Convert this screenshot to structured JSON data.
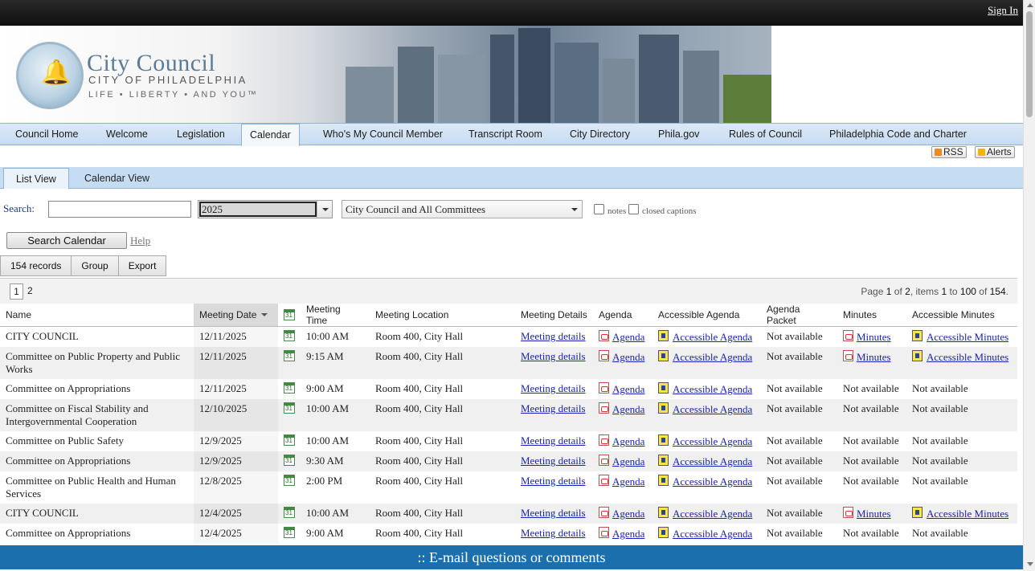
{
  "header": {
    "sign_in": "Sign In"
  },
  "logo": {
    "title": "City Council",
    "subtitle": "CITY OF PHILADELPHIA",
    "tagline": "LIFE • LIBERTY • AND YOU™"
  },
  "nav": {
    "items": [
      "Council Home",
      "Welcome",
      "Legislation",
      "Calendar",
      "Who's My Council Member",
      "Transcript Room",
      "City Directory",
      "Phila.gov",
      "Rules of Council",
      "Philadelphia Code and Charter"
    ],
    "active": "Calendar"
  },
  "feeds": {
    "rss": "RSS",
    "alerts": "Alerts"
  },
  "view_tabs": {
    "list": "List View",
    "calendar": "Calendar View",
    "active": "List View"
  },
  "search": {
    "label": "Search:",
    "input_value": "",
    "year": "2025",
    "body": "City Council and All Committees",
    "notes_label": "notes",
    "captions_label": "closed captions",
    "button": "Search Calendar",
    "help": "Help"
  },
  "grid_toolbar": {
    "records": "154 records",
    "group": "Group",
    "export": "Export"
  },
  "pager": {
    "current": "1",
    "next": "2",
    "info_prefix": "Page",
    "page": "1",
    "of": "of",
    "pages": "2",
    "items": "items",
    "from": "1",
    "to": "to",
    "to_n": "100",
    "total": "154"
  },
  "table": {
    "headers": [
      "Name",
      "Meeting Date",
      "",
      "Meeting Time",
      "Meeting Location",
      "Meeting Details",
      "Agenda",
      "Accessible Agenda",
      "Agenda Packet",
      "Minutes",
      "Accessible Minutes"
    ],
    "rows": [
      {
        "name": "CITY COUNCIL",
        "date": "12/11/2025",
        "time": "10:00 AM",
        "location": "Room 400, City Hall",
        "details": "Meeting details",
        "agenda": "Agenda",
        "acc_agenda": "Accessible Agenda",
        "packet": "Not available",
        "minutes": "Minutes",
        "acc_minutes": "Accessible Minutes"
      },
      {
        "name": "Committee on Public Property and Public Works",
        "date": "12/11/2025",
        "time": "9:15 AM",
        "location": "Room 400, City Hall",
        "details": "Meeting details",
        "agenda": "Agenda",
        "acc_agenda": "Accessible Agenda",
        "packet": "Not available",
        "minutes": "Minutes",
        "acc_minutes": "Accessible Minutes"
      },
      {
        "name": "Committee on Appropriations",
        "date": "12/11/2025",
        "time": "9:00 AM",
        "location": "Room 400, City Hall",
        "details": "Meeting details",
        "agenda": "Agenda",
        "acc_agenda": "Accessible Agenda",
        "packet": "Not available",
        "minutes": "Not available",
        "acc_minutes": "Not available"
      },
      {
        "name": "Committee on Fiscal Stability and Intergovernmental Cooperation",
        "date": "12/10/2025",
        "time": "10:00 AM",
        "location": "Room 400, City Hall",
        "details": "Meeting details",
        "agenda": "Agenda",
        "acc_agenda": "Accessible Agenda",
        "packet": "Not available",
        "minutes": "Not available",
        "acc_minutes": "Not available"
      },
      {
        "name": "Committee on Public Safety",
        "date": "12/9/2025",
        "time": "10:00 AM",
        "location": "Room 400, City Hall",
        "details": "Meeting details",
        "agenda": "Agenda",
        "acc_agenda": "Accessible Agenda",
        "packet": "Not available",
        "minutes": "Not available",
        "acc_minutes": "Not available"
      },
      {
        "name": "Committee on Appropriations",
        "date": "12/9/2025",
        "time": "9:30 AM",
        "location": "Room 400, City Hall",
        "details": "Meeting details",
        "agenda": "Agenda",
        "acc_agenda": "Accessible Agenda",
        "packet": "Not available",
        "minutes": "Not available",
        "acc_minutes": "Not available"
      },
      {
        "name": "Committee on Public Health and Human Services",
        "date": "12/8/2025",
        "time": "2:00 PM",
        "location": "Room 400, City Hall",
        "details": "Meeting details",
        "agenda": "Agenda",
        "acc_agenda": "Accessible Agenda",
        "packet": "Not available",
        "minutes": "Not available",
        "acc_minutes": "Not available"
      },
      {
        "name": "CITY COUNCIL",
        "date": "12/4/2025",
        "time": "10:00 AM",
        "location": "Room 400, City Hall",
        "details": "Meeting details",
        "agenda": "Agenda",
        "acc_agenda": "Accessible Agenda",
        "packet": "Not available",
        "minutes": "Minutes",
        "acc_minutes": "Accessible Minutes"
      },
      {
        "name": "Committee on Appropriations",
        "date": "12/4/2025",
        "time": "9:00 AM",
        "location": "Room 400, City Hall",
        "details": "Meeting details",
        "agenda": "Agenda",
        "acc_agenda": "Accessible Agenda",
        "packet": "Not available",
        "minutes": "Not available",
        "acc_minutes": "Not available"
      }
    ]
  },
  "footer": {
    "text": ":: E-mail questions or comments"
  },
  "icons": {
    "calendar": "calendar-icon",
    "pdf": "pdf-icon",
    "accessible": "accessible-doc-icon",
    "rss": "rss-icon",
    "alerts": "alerts-icon"
  },
  "colors": {
    "nav_bg": "#c7dcf1",
    "footer_bg": "#1b6fad",
    "link": "#1a23b5"
  }
}
